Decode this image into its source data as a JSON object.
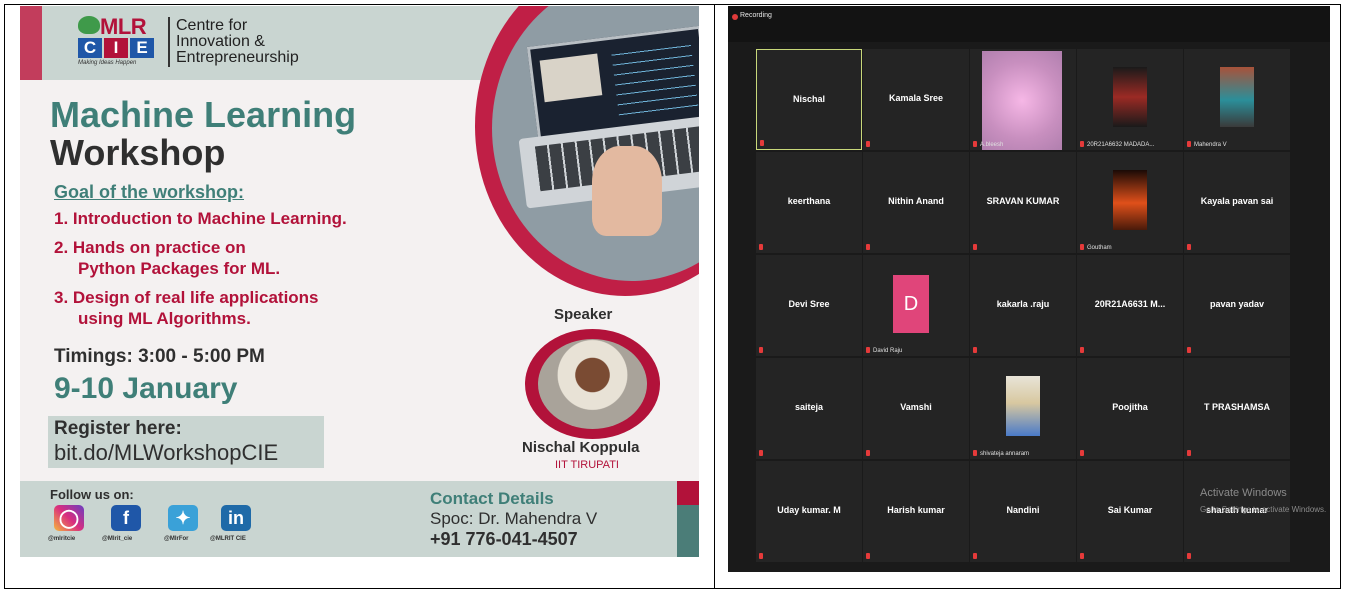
{
  "poster": {
    "logo_mlr": "MLR",
    "logo_cie": [
      "C",
      "I",
      "E"
    ],
    "logo_tagline": "Making Ideas Happen",
    "logo_text_1": "Centre for",
    "logo_text_2": "Innovation &",
    "logo_text_3": "Entrepreneurship",
    "title_line1": "Machine Learning",
    "title_line2": "Workshop",
    "goal_heading": "Goal of the workshop:",
    "goals": [
      "1. Introduction to Machine Learning.",
      "2. Hands on practice on",
      "Python Packages for ML.",
      "3. Design of real life applications",
      "using ML Algorithms."
    ],
    "timings": "Timings:  3:00 - 5:00 PM",
    "dates": "9-10 January",
    "register_label": "Register here:",
    "register_url": "bit.do/MLWorkshopCIE",
    "speaker_label": "Speaker",
    "speaker_name": "Nischal Koppula",
    "speaker_org": "IIT TIRUPATI",
    "follow_label": "Follow us on:",
    "social_handles": [
      "@mlritcie",
      "@Mlrit_cie",
      "@MlrFor",
      "@MLRIT CIE"
    ],
    "social_icons": [
      "instagram-icon",
      "facebook-icon",
      "twitter-icon",
      "linkedin-icon"
    ],
    "contact_title": "Contact Details",
    "contact_spoc": "Spoc: Dr. Mahendra V",
    "contact_phone": "+91 776-041-4507",
    "colors": {
      "teal": "#3f7f78",
      "crimson": "#b2123a",
      "band": "#c9d5d1"
    }
  },
  "zoom": {
    "recording_label": "Recording",
    "participants": [
      {
        "name": "Nischal",
        "type": "text",
        "active": true
      },
      {
        "name": "Kamala Sree",
        "type": "text"
      },
      {
        "name": "A.bleesh",
        "type": "video",
        "caption": "A.bleesh"
      },
      {
        "name": "20R21A6632 MADADA...",
        "type": "video",
        "caption": "20R21A6632 MADADA..."
      },
      {
        "name": "Mahendra V",
        "type": "video",
        "caption": "Mahendra V"
      },
      {
        "name": "keerthana",
        "type": "text"
      },
      {
        "name": "Nithin Anand",
        "type": "text"
      },
      {
        "name": "SRAVAN KUMAR",
        "type": "text"
      },
      {
        "name": "Goutham",
        "type": "video",
        "caption": "Goutham"
      },
      {
        "name": "Kayala pavan sai",
        "type": "text"
      },
      {
        "name": "Devi Sree",
        "type": "text"
      },
      {
        "name": "David Raju",
        "type": "avatar",
        "initial": "D",
        "caption": "David Raju"
      },
      {
        "name": "kakarla .raju",
        "type": "text"
      },
      {
        "name": "20R21A6631 M...",
        "type": "text"
      },
      {
        "name": "pavan yadav",
        "type": "text"
      },
      {
        "name": "saiteja",
        "type": "text"
      },
      {
        "name": "Vamshi",
        "type": "text"
      },
      {
        "name": "shivateja annaram",
        "type": "video",
        "caption": "shivateja annaram"
      },
      {
        "name": "Poojitha",
        "type": "text"
      },
      {
        "name": "T PRASHAMSA",
        "type": "text"
      },
      {
        "name": "Uday kumar. M",
        "type": "text"
      },
      {
        "name": "Harish kumar",
        "type": "text"
      },
      {
        "name": "Nandini",
        "type": "text"
      },
      {
        "name": "Sai Kumar",
        "type": "text"
      },
      {
        "name": "sharath kumar",
        "type": "text"
      }
    ],
    "watermark_line1": "Activate Windows",
    "watermark_line2": "Go to Settings to activate Windows."
  }
}
